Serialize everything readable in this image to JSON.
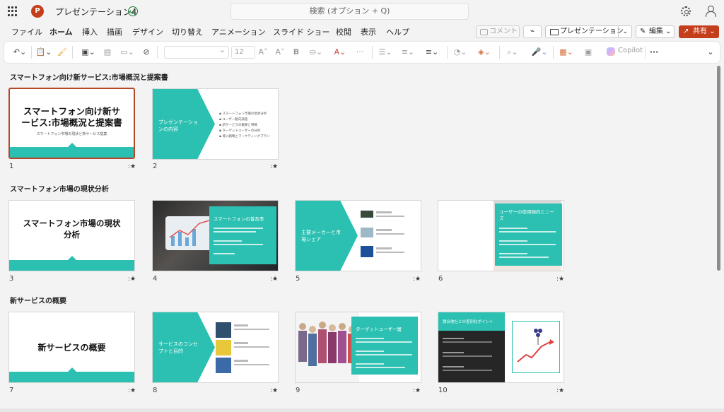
{
  "app": {
    "logo_letter": "P",
    "doc_title": "プレゼンテーション4",
    "search_placeholder": "検索 (オプション + Q)"
  },
  "menu": {
    "tabs": [
      "ファイル",
      "ホーム",
      "挿入",
      "描画",
      "デザイン",
      "切り替え",
      "アニメーション",
      "スライド ショー",
      "校閲",
      "表示",
      "ヘルプ"
    ],
    "active_tab": "ホーム",
    "comment_label": "コメント",
    "present_label": "プレゼンテーション",
    "edit_label": "編集",
    "share_label": "共有"
  },
  "ribbon": {
    "font_size": "12",
    "copilot_label": "Copilot"
  },
  "sections": [
    {
      "title": "スマートフォン向け新サービス:市場概況と提案書",
      "slides": [
        {
          "number": "1",
          "title": "スマートフォン向け新サービス:市場概況と提案書",
          "subtitle": "スマートフォン市場の現状と新サービス提案"
        },
        {
          "number": "2",
          "title": "プレゼンテーションの内容",
          "bullets": [
            "スマートフォン市場の現状分析",
            "ユーザー動向調査",
            "新サービスの概要と特徴",
            "ターゲットユーザーの分析",
            "導入戦略とマーケティングプラン"
          ]
        }
      ]
    },
    {
      "title": "スマートフォン市場の現状分析",
      "slides": [
        {
          "number": "3",
          "title": "スマートフォン市場の現状分析"
        },
        {
          "number": "4",
          "title": "スマートフォンの普及率"
        },
        {
          "number": "5",
          "title": "主要メーカーと市場シェア"
        },
        {
          "number": "6",
          "title": "ユーザーの使用傾向とニーズ"
        }
      ]
    },
    {
      "title": "新サービスの概要",
      "slides": [
        {
          "number": "7",
          "title": "新サービスの概要"
        },
        {
          "number": "8",
          "title": "サービスのコンセプトと目的"
        },
        {
          "number": "9",
          "title": "ターゲットユーザー層"
        },
        {
          "number": "10",
          "title": "競合他社との差別化ポイント"
        }
      ]
    }
  ],
  "colors": {
    "accent_teal": "#2bc0b1",
    "brand_red": "#c43e1c",
    "selection": "#b7472a"
  },
  "icons": {
    "star_glyph": "★",
    "note_glyph": ":"
  }
}
